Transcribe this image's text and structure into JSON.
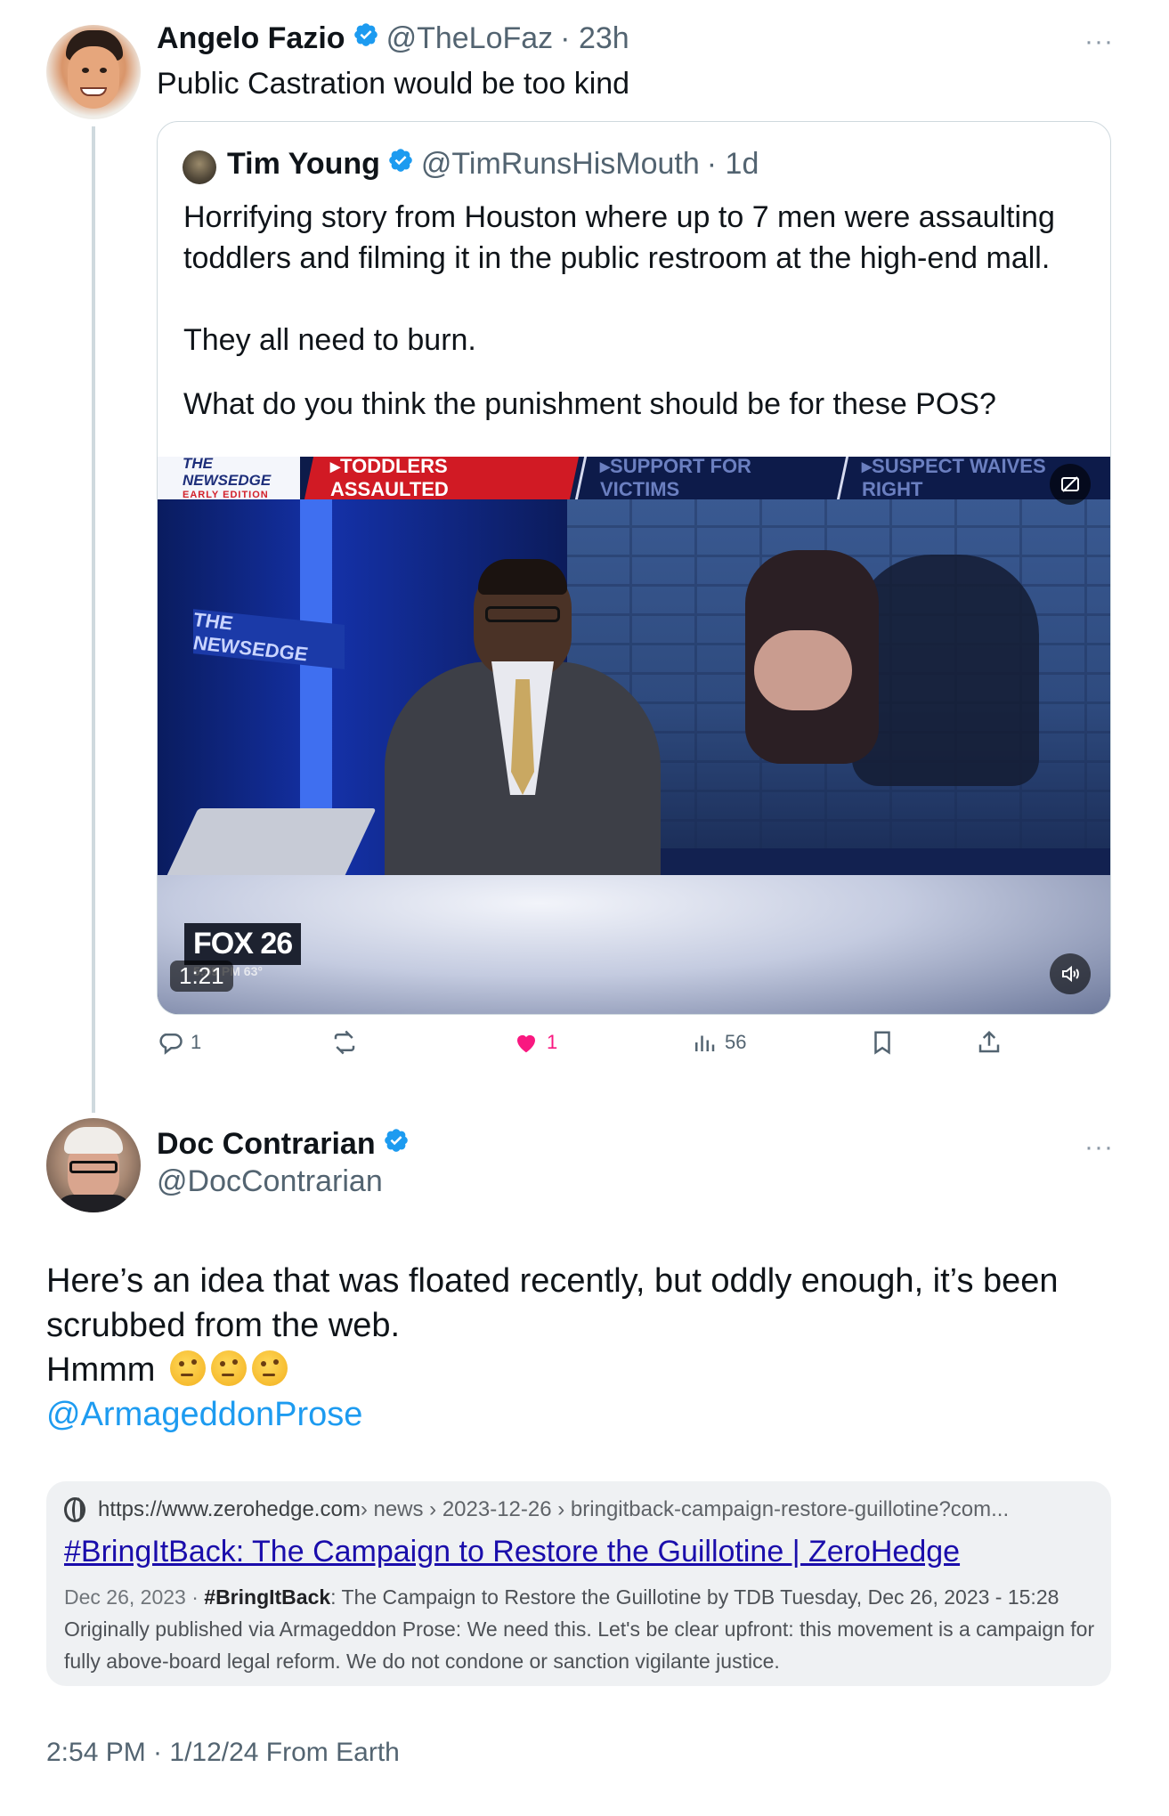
{
  "tweet1": {
    "name": "Angelo Fazio",
    "handle": "@TheLoFaz",
    "time": "· 23h",
    "text": "Public Castration would be too kind",
    "more": "···",
    "quote": {
      "name": "Tim Young",
      "handle": "@TimRunsHisMouth",
      "time": "· 1d",
      "para1": "Horrifying story from Houston where up to 7 men were assaulting\ntoddlers and filming it in the public restroom at the high-end mall.",
      "para2": "They all need to burn.",
      "para3": "What do you think the punishment should be for these POS?",
      "video": {
        "ticker_logo_top": "THE NEWSEDGE",
        "ticker_logo_sub": "EARLY EDITION",
        "ticker_red": "▸TODDLERS ASSAULTED",
        "ticker_item1": "▸SUPPORT FOR VICTIMS",
        "ticker_item2": "▸SUSPECT WAIVES RIGHT",
        "studio_logo": "THE NEWSEDGE",
        "station": "FOX 26",
        "station_sub": "5:59 PM   63°",
        "duration": "1:21"
      }
    },
    "actions": {
      "reply_count": "1",
      "like_count": "1",
      "views_count": "56"
    }
  },
  "tweet2": {
    "name": "Doc Contrarian",
    "handle": "@DocContrarian",
    "more": "···",
    "line1": "Here’s an idea that was floated recently, but oddly enough, it’s been",
    "line2": "scrubbed from the web.",
    "line3": "Hmmm",
    "mention": "@ArmageddonProse",
    "link": {
      "domain": "https://www.zerohedge.com",
      "path": " › news › 2023-12-26 › bringitback-campaign-restore-guillotine?com...",
      "title": "#BringItBack: The Campaign to Restore the Guillotine | ZeroHedge",
      "date": "Dec 26, 2023",
      "snippet_bold": "#BringItBack",
      "snippet": ": The Campaign to Restore the Guillotine by TDB Tuesday, Dec 26, 2023 - 15:28 Originally published via Armageddon Prose: We need this. Let's be clear upfront: this movement is a campaign for fully above-board legal reform. We do not condone or sanction vigilante justice."
    },
    "footer": "2:54 PM · 1/12/24 From Earth"
  },
  "colors": {
    "verified": "#1d9bf0",
    "like": "#f91880",
    "link_title": "#1a0dab",
    "muted": "#536471"
  }
}
